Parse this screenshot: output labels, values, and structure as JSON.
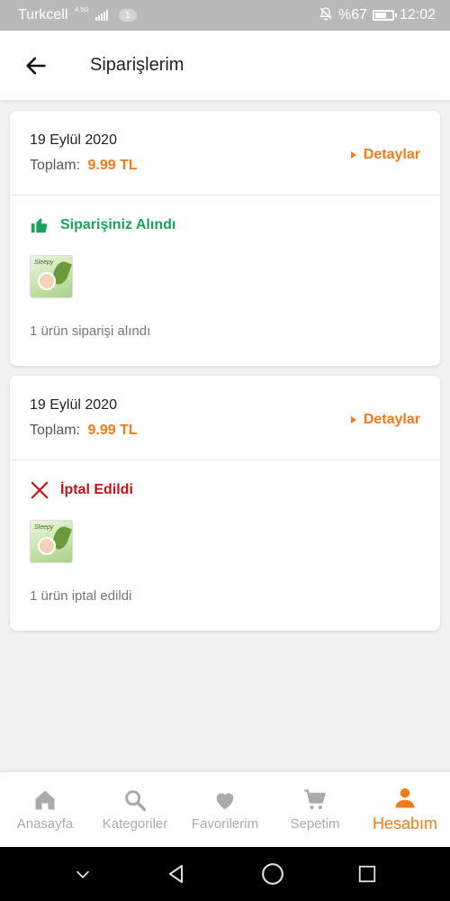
{
  "status_bar": {
    "carrier": "Turkcell",
    "network_type": "4.5G",
    "notification_count": "1",
    "battery_text": "%67",
    "battery_level": 0.67,
    "time": "12:02"
  },
  "header": {
    "title": "Siparişlerim"
  },
  "orders": [
    {
      "date": "19 Eylül 2020",
      "total_label": "Toplam:",
      "total_amount": "9.99 TL",
      "details_label": "Detaylar",
      "status_text": "Siparişiniz Alındı",
      "status_type": "received",
      "product_thumb_brand": "Sleepy",
      "summary": "1 ürün siparişi alındı"
    },
    {
      "date": "19 Eylül 2020",
      "total_label": "Toplam:",
      "total_amount": "9.99 TL",
      "details_label": "Detaylar",
      "status_text": "İptal Edildi",
      "status_type": "cancelled",
      "product_thumb_brand": "Sleepy",
      "summary": "1 ürün iptal edildi"
    }
  ],
  "bottom_nav": [
    {
      "label": "Anasayfa",
      "icon": "home-icon"
    },
    {
      "label": "Kategoriler",
      "icon": "search-icon"
    },
    {
      "label": "Favorilerim",
      "icon": "heart-icon"
    },
    {
      "label": "Sepetim",
      "icon": "cart-icon"
    },
    {
      "label": "Hesabım",
      "icon": "user-icon",
      "active": true
    }
  ],
  "colors": {
    "accent": "#f27a1a",
    "success": "#1aa45b",
    "danger": "#c0141b",
    "inactive": "#aaaaaa"
  }
}
